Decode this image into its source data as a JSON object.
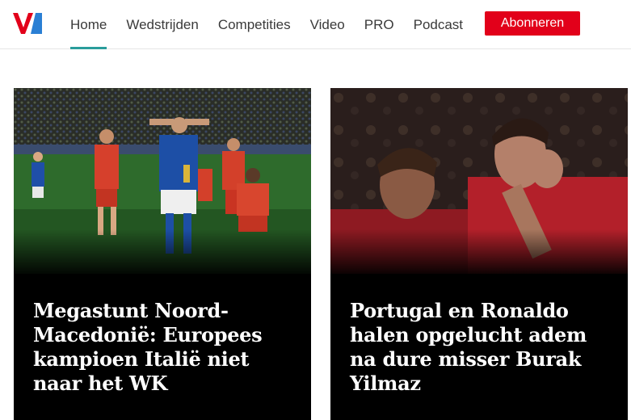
{
  "header": {
    "logo_icon": "vi-logo-icon",
    "nav": [
      {
        "label": "Home",
        "active": true
      },
      {
        "label": "Wedstrijden"
      },
      {
        "label": "Competities"
      },
      {
        "label": "Video"
      },
      {
        "label": "PRO"
      },
      {
        "label": "Podcast"
      }
    ],
    "subscribe_label": "Abonneren"
  },
  "articles": [
    {
      "title": "Megastunt Noord-Macedonië: Europees kampioen Italië niet naar het WK"
    },
    {
      "title": "Portugal en Ronaldo halen opgelucht adem na dure misser Burak Yilmaz"
    }
  ],
  "colors": {
    "accent": "#2a9d9c",
    "brand_red": "#e2001a"
  }
}
